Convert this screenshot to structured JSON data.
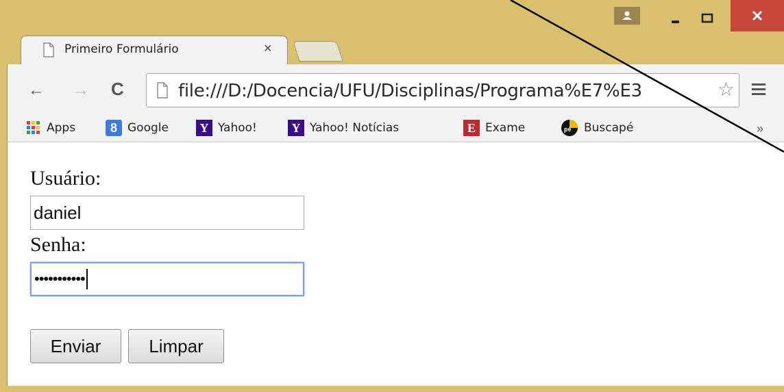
{
  "window": {
    "caption_buttons": [
      "user",
      "minimize",
      "maximize",
      "close"
    ],
    "frame_color": "#d9bf6e",
    "close_color": "#c7463a"
  },
  "tabs": [
    {
      "title": "Primeiro Formulário",
      "close_label": "×",
      "icon": "page-icon"
    }
  ],
  "toolbar": {
    "back_icon": "←",
    "forward_icon": "→",
    "reload_icon": "C",
    "url": "file:///D:/Docencia/UFU/Disciplinas/Programa%E7%E3",
    "star_icon": "☆",
    "menu_icon": "hamburger-icon"
  },
  "bookmarks": {
    "items": [
      {
        "label": "Apps",
        "icon": "apps-grid-icon"
      },
      {
        "label": "Google",
        "icon": "8",
        "color": "#3d7be0"
      },
      {
        "label": "Yahoo!",
        "icon": "Y",
        "color": "#3b0b8a"
      },
      {
        "label": "Yahoo! Notícias",
        "icon": "Y",
        "color": "#3b0b8a"
      },
      {
        "label": "Exame",
        "icon": "E",
        "color": "#c0282d"
      },
      {
        "label": "Buscapé",
        "icon": "buscape-icon",
        "color": "#f1b600"
      }
    ],
    "more": "»"
  },
  "form": {
    "user_label": "Usuário:",
    "user_value": "daniel",
    "password_label": "Senha:",
    "password_value": "•••••••••••",
    "submit_label": "Enviar",
    "reset_label": "Limpar"
  }
}
